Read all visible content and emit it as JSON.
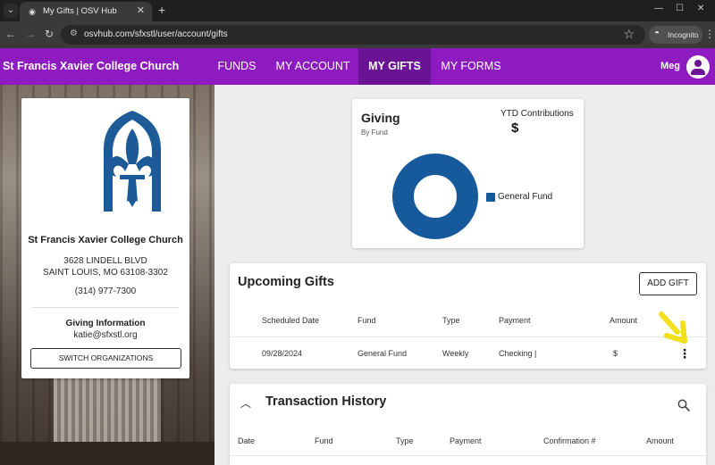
{
  "browser": {
    "tab_title": "My Gifts | OSV Hub",
    "url": "osvhub.com/sfxstl/user/account/gifts",
    "incognito_label": "Incognito"
  },
  "nav": {
    "brand": "St Francis Xavier College Church",
    "links": [
      "FUNDS",
      "MY ACCOUNT",
      "MY GIFTS",
      "MY FORMS"
    ],
    "active": "MY GIFTS",
    "user_name": "Meg"
  },
  "org": {
    "name": "St Francis Xavier College Church",
    "address_line1": "3628 LINDELL BLVD",
    "address_line2": "SAINT LOUIS, MO 63108-3302",
    "phone": "(314) 977-7300",
    "giving_info_label": "Giving Information",
    "giving_info_email": "katie@sfxstl.org",
    "switch_label": "SWITCH ORGANIZATIONS",
    "logo_color": "#1c5a98"
  },
  "giving": {
    "title": "Giving",
    "subtitle": "By Fund",
    "ytd_label": "YTD Contributions",
    "ytd_value": "$",
    "chart_data": {
      "type": "pie",
      "categories": [
        "General Fund"
      ],
      "values": [
        100
      ],
      "legend_placement": "right",
      "colors": [
        "#175a9c"
      ]
    }
  },
  "upcoming": {
    "title": "Upcoming Gifts",
    "add_gift_label": "ADD GIFT",
    "columns": [
      "Scheduled Date",
      "Fund",
      "Type",
      "Payment",
      "Amount"
    ],
    "rows": [
      {
        "date": "09/28/2024",
        "fund": "General Fund",
        "type": "Weekly",
        "payment": "Checking |",
        "amount": "$"
      }
    ]
  },
  "history": {
    "title": "Transaction History",
    "columns": [
      "Date",
      "Fund",
      "Type",
      "Payment",
      "Confirmation #",
      "Amount"
    ]
  },
  "colors": {
    "nav_purple": "#8e1bbf",
    "nav_active": "#6a1395",
    "annotation_arrow": "#f2e01c"
  }
}
